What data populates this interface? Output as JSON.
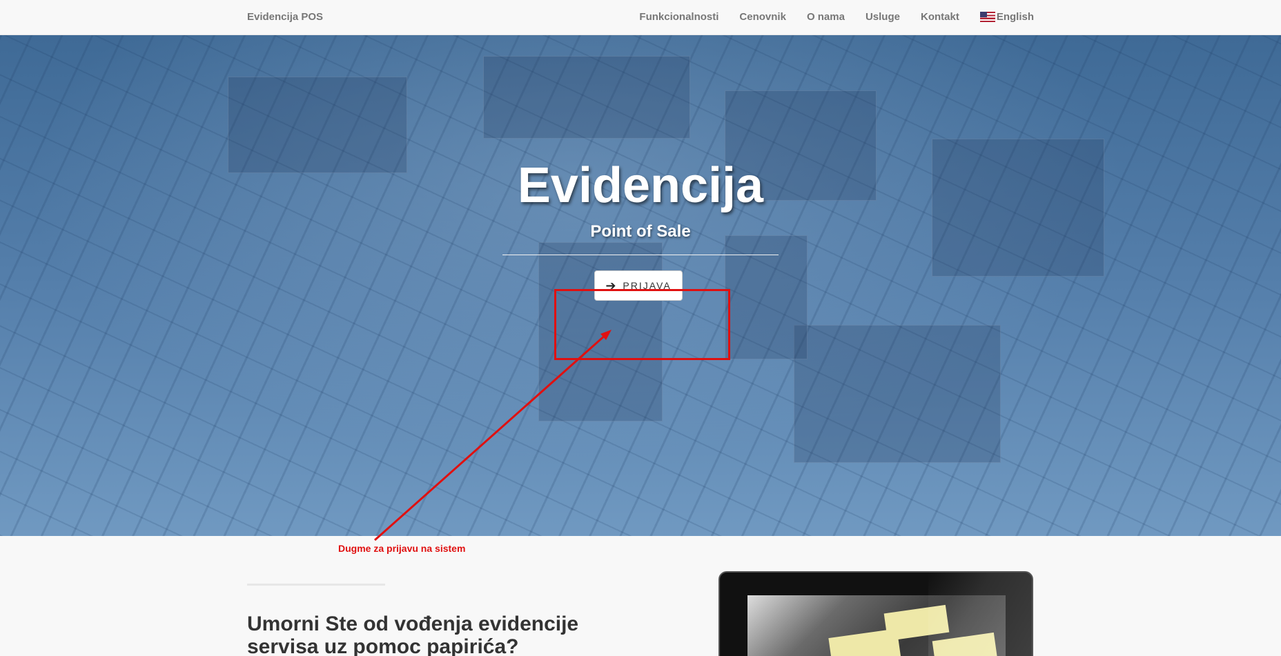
{
  "navbar": {
    "brand": "Evidencija POS",
    "items": [
      {
        "label": "Funkcionalnosti"
      },
      {
        "label": "Cenovnik"
      },
      {
        "label": "O nama"
      },
      {
        "label": "Usluge"
      },
      {
        "label": "Kontakt"
      }
    ],
    "language": {
      "label": "English",
      "icon": "us-flag-icon"
    }
  },
  "hero": {
    "title": "Evidencija",
    "subtitle": "Point of Sale",
    "login_button": {
      "label": "PRIJAVA",
      "icon": "arrow-right-icon"
    }
  },
  "annotation": {
    "text": "Dugme za prijavu na sistem",
    "color": "#e01010"
  },
  "content": {
    "heading": "Umorni Ste od vođenja evidencije servisa uz pomoc papirića?"
  },
  "colors": {
    "hero_top": "#3f6a96",
    "hero_bottom": "#7099c1",
    "navbar_bg": "#f8f8f8",
    "annotation_red": "#e01010"
  }
}
